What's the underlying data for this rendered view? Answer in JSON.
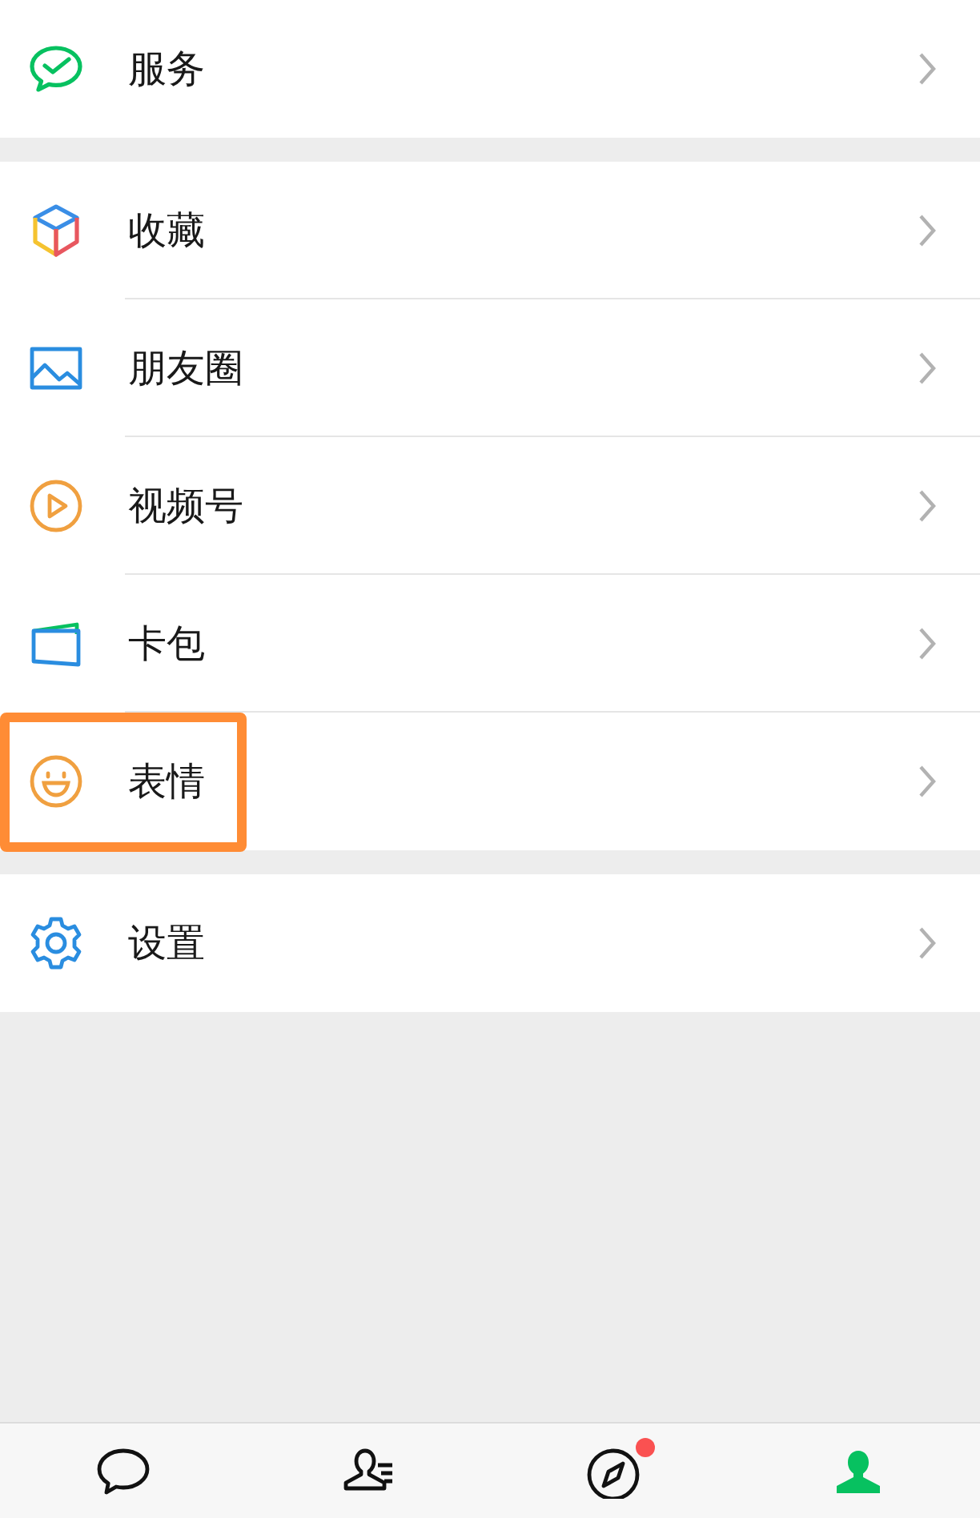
{
  "sections": [
    {
      "items": [
        {
          "kind": "service",
          "label": "服务",
          "highlighted": false
        }
      ]
    },
    {
      "items": [
        {
          "kind": "favorites",
          "label": "收藏",
          "highlighted": false
        },
        {
          "kind": "moments",
          "label": "朋友圈",
          "highlighted": false
        },
        {
          "kind": "channels",
          "label": "视频号",
          "highlighted": false
        },
        {
          "kind": "cards",
          "label": "卡包",
          "highlighted": false
        },
        {
          "kind": "stickers",
          "label": "表情",
          "highlighted": true
        }
      ]
    },
    {
      "items": [
        {
          "kind": "settings",
          "label": "设置",
          "highlighted": false
        }
      ]
    }
  ],
  "tab_bar": [
    {
      "kind": "chats",
      "selected": false,
      "dot": false
    },
    {
      "kind": "contacts",
      "selected": false,
      "dot": false
    },
    {
      "kind": "discover",
      "selected": false,
      "dot": true
    },
    {
      "kind": "me",
      "selected": true,
      "dot": false
    }
  ]
}
